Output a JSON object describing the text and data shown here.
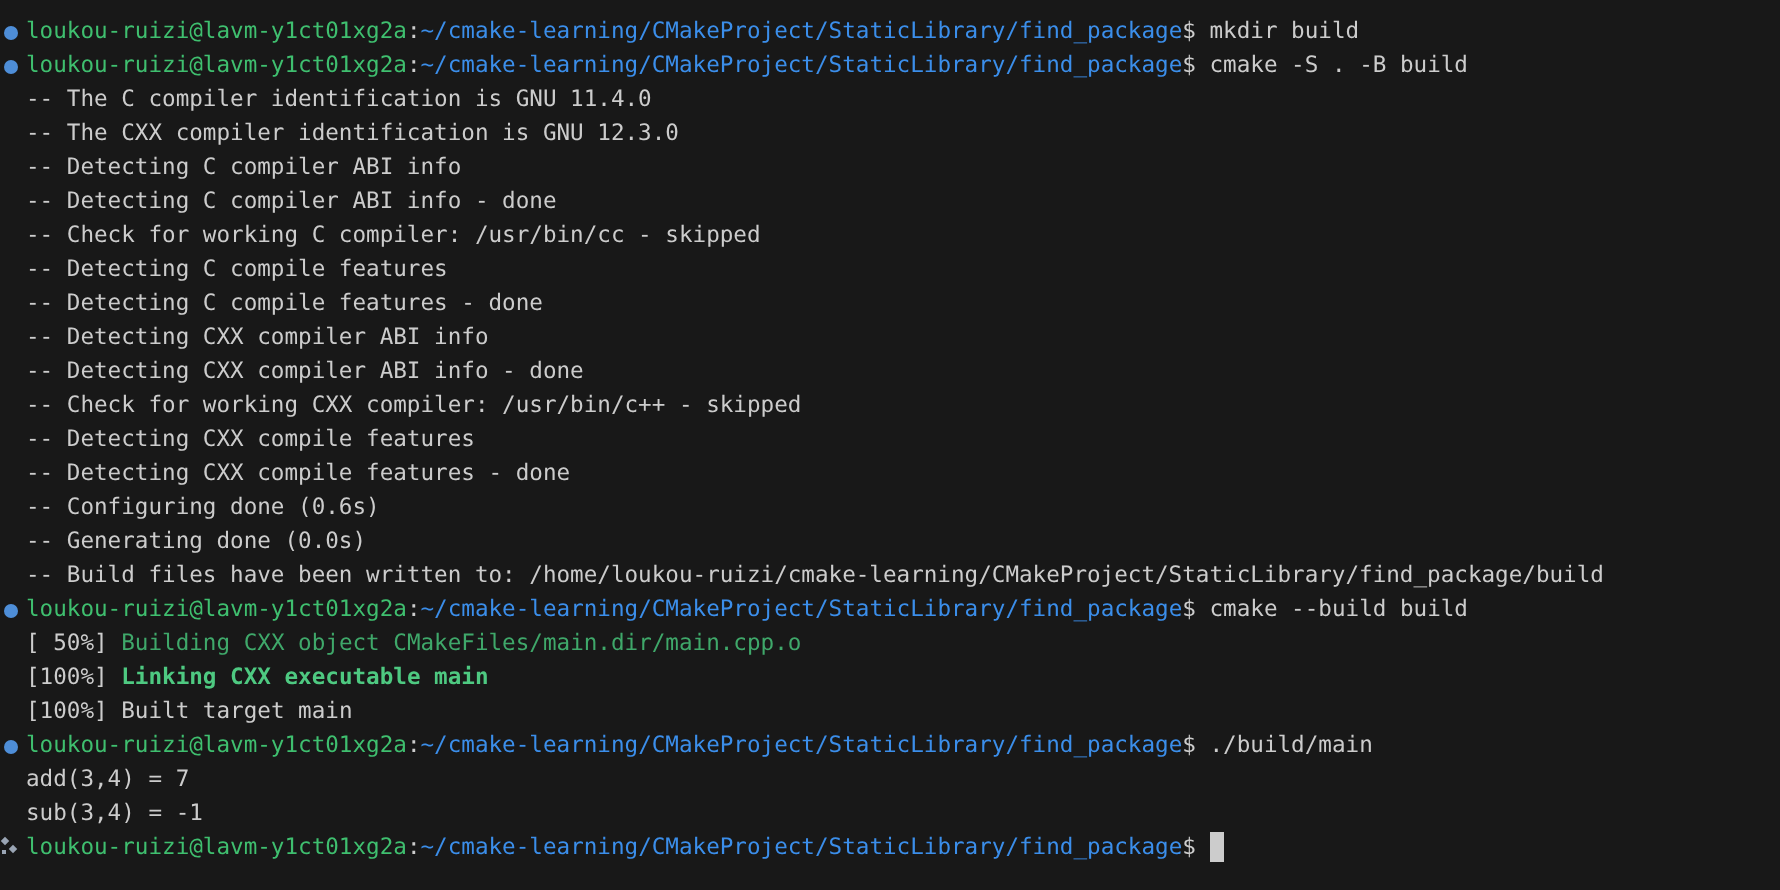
{
  "lines": [
    {
      "kind": "prompt",
      "user_host": "loukou-ruizi@lavm-y1ct01xg2a",
      "separator": ":",
      "path": "~/cmake-learning/CMakeProject/StaticLibrary/find_package",
      "symbol": "$",
      "command": "mkdir build"
    },
    {
      "kind": "prompt",
      "user_host": "loukou-ruizi@lavm-y1ct01xg2a",
      "separator": ":",
      "path": "~/cmake-learning/CMakeProject/StaticLibrary/find_package",
      "symbol": "$",
      "command": "cmake -S . -B build"
    },
    {
      "kind": "output",
      "text": "-- The C compiler identification is GNU 11.4.0"
    },
    {
      "kind": "output",
      "text": "-- The CXX compiler identification is GNU 12.3.0"
    },
    {
      "kind": "output",
      "text": "-- Detecting C compiler ABI info"
    },
    {
      "kind": "output",
      "text": "-- Detecting C compiler ABI info - done"
    },
    {
      "kind": "output",
      "text": "-- Check for working C compiler: /usr/bin/cc - skipped"
    },
    {
      "kind": "output",
      "text": "-- Detecting C compile features"
    },
    {
      "kind": "output",
      "text": "-- Detecting C compile features - done"
    },
    {
      "kind": "output",
      "text": "-- Detecting CXX compiler ABI info"
    },
    {
      "kind": "output",
      "text": "-- Detecting CXX compiler ABI info - done"
    },
    {
      "kind": "output",
      "text": "-- Check for working CXX compiler: /usr/bin/c++ - skipped"
    },
    {
      "kind": "output",
      "text": "-- Detecting CXX compile features"
    },
    {
      "kind": "output",
      "text": "-- Detecting CXX compile features - done"
    },
    {
      "kind": "output",
      "text": "-- Configuring done (0.6s)"
    },
    {
      "kind": "output",
      "text": "-- Generating done (0.0s)"
    },
    {
      "kind": "output",
      "text": "-- Build files have been written to: /home/loukou-ruizi/cmake-learning/CMakeProject/StaticLibrary/find_package/build"
    },
    {
      "kind": "prompt",
      "user_host": "loukou-ruizi@lavm-y1ct01xg2a",
      "separator": ":",
      "path": "~/cmake-learning/CMakeProject/StaticLibrary/find_package",
      "symbol": "$",
      "command": "cmake --build build"
    },
    {
      "kind": "compile",
      "counter": "[ 50%]",
      "message": "Building CXX object CMakeFiles/main.dir/main.cpp.o"
    },
    {
      "kind": "link",
      "counter": "[100%]",
      "message": "Linking CXX executable main"
    },
    {
      "kind": "target",
      "counter": "[100%]",
      "message": "Built target main"
    },
    {
      "kind": "prompt",
      "user_host": "loukou-ruizi@lavm-y1ct01xg2a",
      "separator": ":",
      "path": "~/cmake-learning/CMakeProject/StaticLibrary/find_package",
      "symbol": "$",
      "command": "./build/main"
    },
    {
      "kind": "output",
      "text": "add(3,4) = 7"
    },
    {
      "kind": "output",
      "text": "sub(3,4) = -1"
    },
    {
      "kind": "active",
      "user_host": "loukou-ruizi@lavm-y1ct01xg2a",
      "separator": ":",
      "path": "~/cmake-learning/CMakeProject/StaticLibrary/find_package",
      "symbol": "$"
    }
  ]
}
